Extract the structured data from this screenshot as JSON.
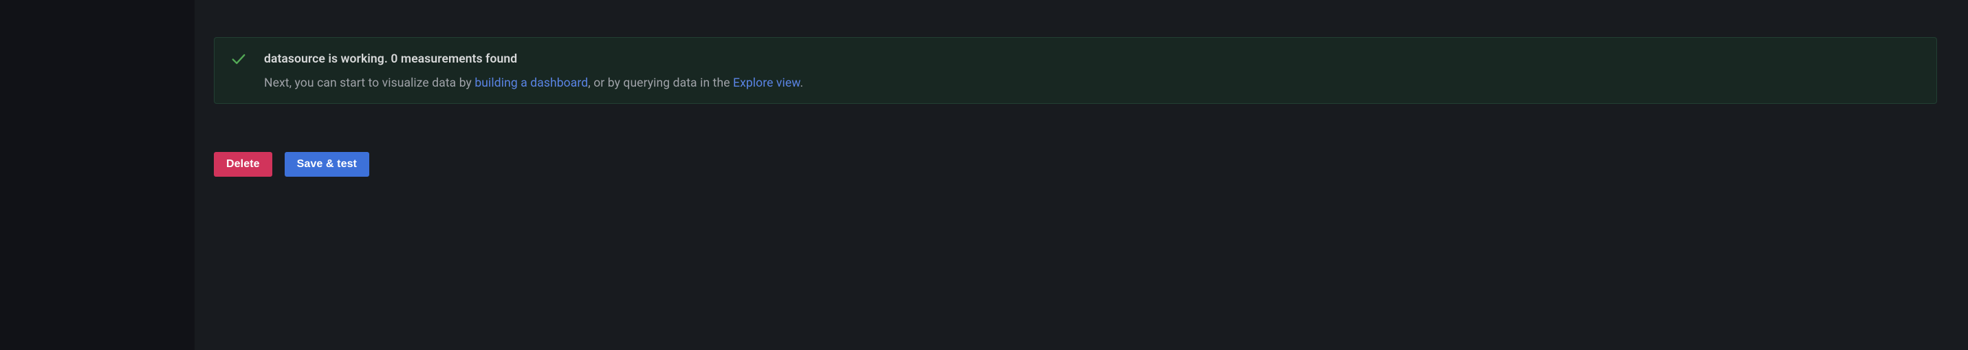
{
  "alert": {
    "title": "datasource is working. 0 measurements found",
    "body_prefix": "Next, you can start to visualize data by ",
    "link_dashboard": "building a dashboard",
    "body_mid": ", or by querying data in the ",
    "link_explore": "Explore view",
    "body_suffix": "."
  },
  "buttons": {
    "delete": "Delete",
    "save_test": "Save & test"
  },
  "icons": {
    "check": "check-icon"
  },
  "colors": {
    "success_border": "#224033",
    "success_bg": "#182722",
    "success_icon": "#53a956",
    "link": "#5a84e4",
    "btn_delete": "#d1345b",
    "btn_primary": "#3d71d9",
    "page_bg": "#181b1f",
    "sidebar_bg": "#111217"
  }
}
